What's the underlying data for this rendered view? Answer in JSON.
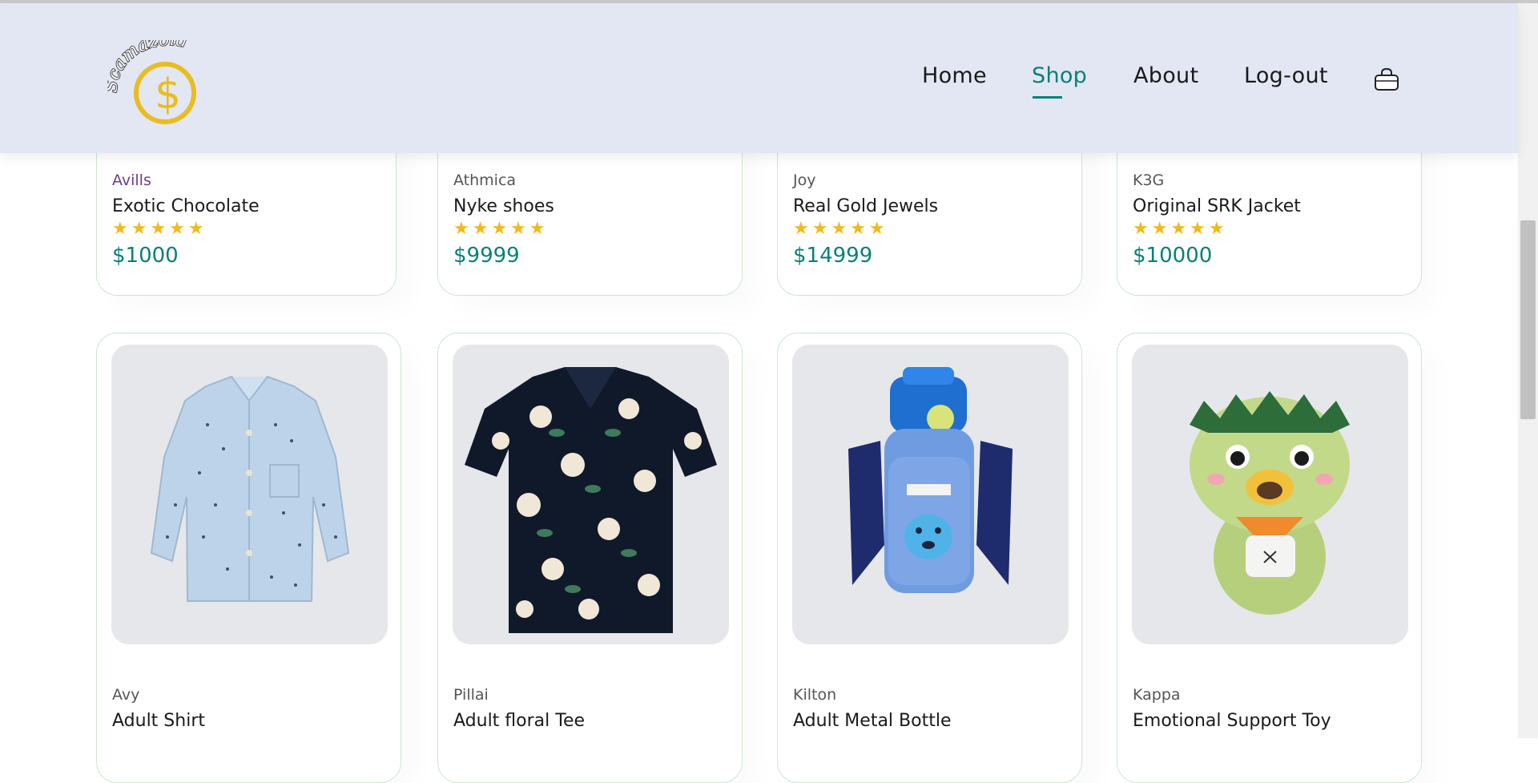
{
  "header": {
    "nav": [
      {
        "label": "Home",
        "active": false
      },
      {
        "label": "Shop",
        "active": true
      },
      {
        "label": "About",
        "active": false
      },
      {
        "label": "Log-out",
        "active": false
      }
    ],
    "cart_icon": "shopping-bag-icon",
    "logo_text": "Scamazoid"
  },
  "products_top": [
    {
      "brand": "Avills",
      "name": "Exotic Chocolate",
      "stars": "★★★★★",
      "price": "$1000"
    },
    {
      "brand": "Athmica",
      "name": "Nyke shoes",
      "stars": "★★★★★",
      "price": "$9999"
    },
    {
      "brand": "Joy",
      "name": "Real Gold Jewels",
      "stars": "★★★★★",
      "price": "$14999"
    },
    {
      "brand": "K3G",
      "name": "Original SRK Jacket",
      "stars": "★★★★★",
      "price": "$10000"
    }
  ],
  "products_bottom": [
    {
      "brand": "Avy",
      "name": "Adult Shirt"
    },
    {
      "brand": "Pillai",
      "name": "Adult floral Tee"
    },
    {
      "brand": "Kilton",
      "name": "Adult Metal Bottle"
    },
    {
      "brand": "Kappa",
      "name": "Emotional Support Toy"
    }
  ],
  "images": [
    "light-blue-shirt-image",
    "floral-shirt-image",
    "blue-bottle-image",
    "green-plush-toy-image"
  ],
  "colors": {
    "accent": "#088178",
    "star": "#f3b81c",
    "header_bg": "#e3e6f3",
    "brand_purple": "#6a3d8f"
  }
}
